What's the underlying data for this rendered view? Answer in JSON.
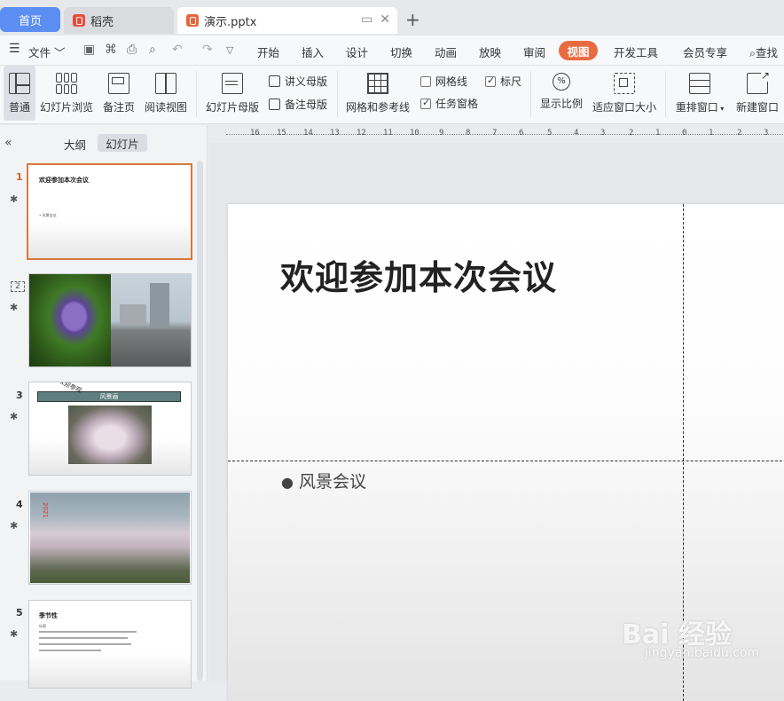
{
  "tabs": {
    "home": "首页",
    "daoke": "稻壳",
    "file": "演示.pptx"
  },
  "menu": {
    "file": "文件",
    "items": [
      "开始",
      "插入",
      "设计",
      "切换",
      "动画",
      "放映",
      "审阅",
      "视图",
      "开发工具",
      "会员专享"
    ],
    "search": "查找"
  },
  "ribbon": {
    "normal": "普通",
    "slide_sorter": "幻灯片浏览",
    "notes_page": "备注页",
    "reading_view": "阅读视图",
    "slide_master": "幻灯片母版",
    "handout_master": "讲义母版",
    "notes_master": "备注母版",
    "grid_guides": "网格和参考线",
    "gridlines": "网格线",
    "ruler": "标尺",
    "task_pane": "任务窗格",
    "zoom": "显示比例",
    "fit_window": "适应窗口大小",
    "arrange": "重排窗口",
    "new_window": "新建窗口"
  },
  "checks": {
    "gridlines": false,
    "ruler": true,
    "task_pane": true
  },
  "left_pane": {
    "outline_tab": "大纲",
    "slides_tab": "幻灯片",
    "thumbnails": [
      {
        "num": "1",
        "title": "欢迎参加本次会议",
        "sub": "• 风景会议"
      },
      {
        "num": "2"
      },
      {
        "num": "3",
        "title": "风景画",
        "note": "欢迎参观"
      },
      {
        "num": "4",
        "label": "2021"
      },
      {
        "num": "5",
        "title": "季节性",
        "sub": "标题"
      }
    ]
  },
  "ruler_labels": [
    "16",
    "15",
    "14",
    "13",
    "12",
    "11",
    "10",
    "9",
    "8",
    "7",
    "6",
    "5",
    "4",
    "3",
    "2",
    "1",
    "0",
    "1",
    "2",
    "3"
  ],
  "slide": {
    "title": "欢迎参加本次会议",
    "bullet": "风景会议"
  },
  "watermark": {
    "brand": "Bai 经验",
    "url": "jingyan.baidu.com"
  },
  "colors": {
    "accent": "#ea6a3f",
    "home_tab": "#5b8ef0"
  }
}
